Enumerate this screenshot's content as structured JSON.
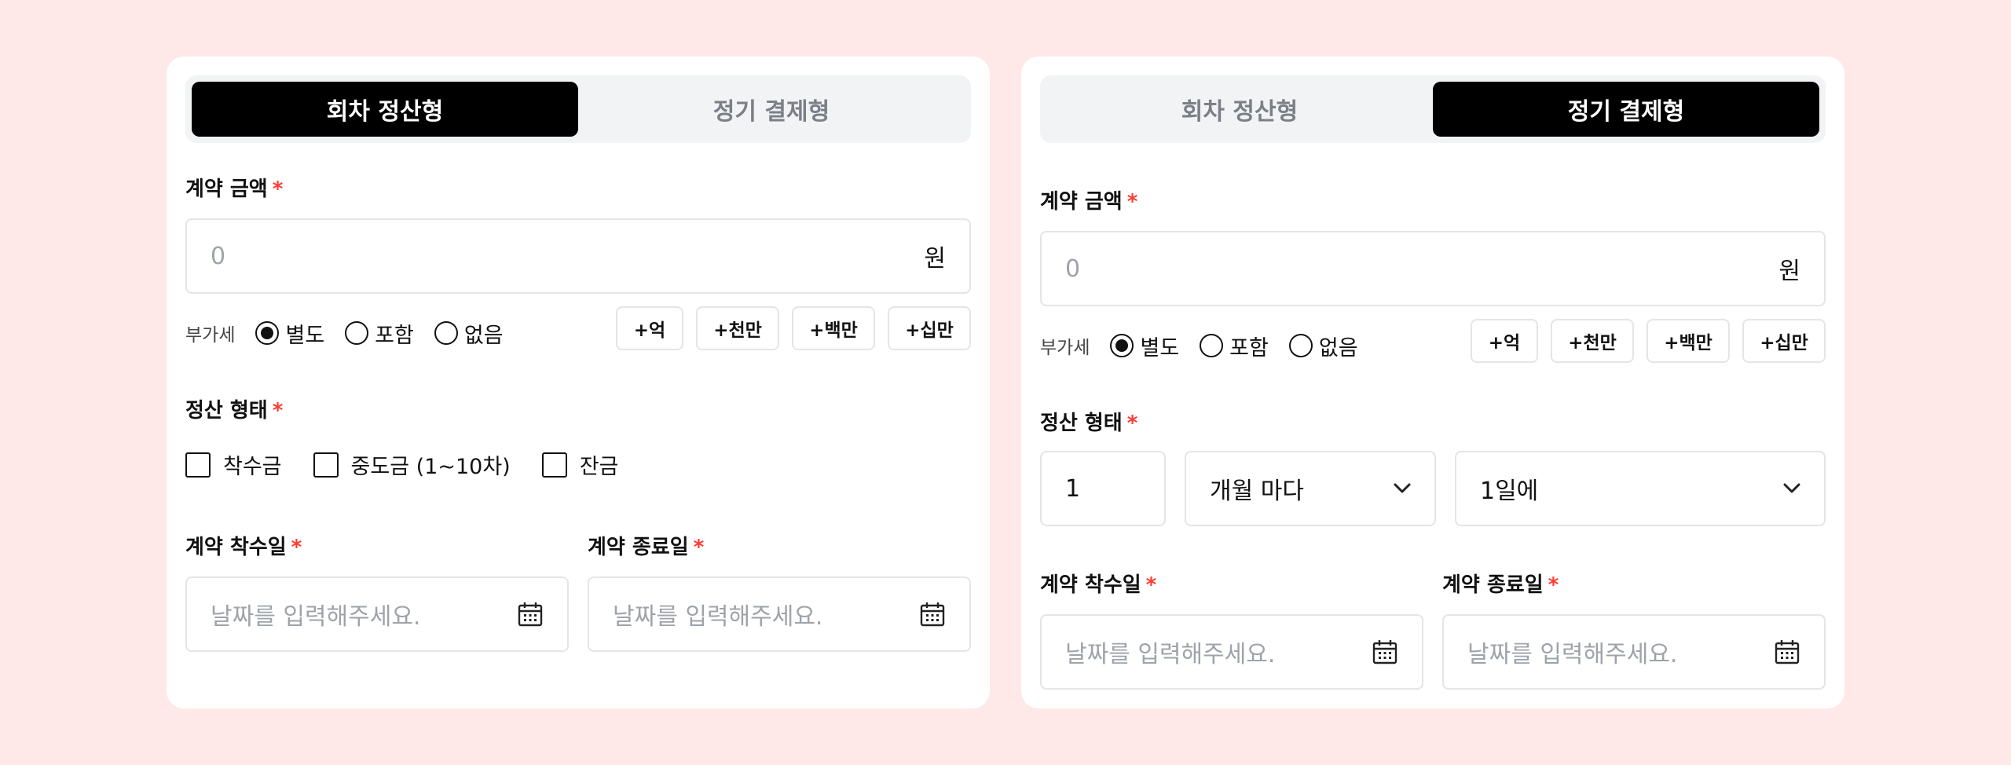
{
  "left_card": {
    "tabs": [
      {
        "label": "회차 정산형",
        "active": true
      },
      {
        "label": "정기 결제형",
        "active": false
      }
    ],
    "amount_label": "계약 금액",
    "amount_placeholder": "0",
    "amount_unit": "원",
    "vat_label": "부가세",
    "vat_options": [
      {
        "label": "별도",
        "selected": true
      },
      {
        "label": "포함",
        "selected": false
      },
      {
        "label": "없음",
        "selected": false
      }
    ],
    "quick_buttons": [
      "+억",
      "+천만",
      "+백만",
      "+십만"
    ],
    "settlement_label": "정산 형태",
    "settlement_checks": [
      "착수금",
      "중도금 (1~10차)",
      "잔금"
    ],
    "start_label": "계약 착수일",
    "end_label": "계약 종료일",
    "date_placeholder": "날짜를 입력해주세요."
  },
  "right_card": {
    "tabs": [
      {
        "label": "회차 정산형",
        "active": false
      },
      {
        "label": "정기 결제형",
        "active": true
      }
    ],
    "amount_label": "계약 금액",
    "amount_placeholder": "0",
    "amount_unit": "원",
    "vat_label": "부가세",
    "vat_options": [
      {
        "label": "별도",
        "selected": true
      },
      {
        "label": "포함",
        "selected": false
      },
      {
        "label": "없음",
        "selected": false
      }
    ],
    "quick_buttons": [
      "+억",
      "+천만",
      "+백만",
      "+십만"
    ],
    "settlement_label": "정산 형태",
    "period_value": "1",
    "period_unit": "개월 마다",
    "day_value": "1일에",
    "start_label": "계약 착수일",
    "end_label": "계약 종료일",
    "date_placeholder": "날짜를 입력해주세요."
  },
  "required_mark": "*",
  "colors": {
    "background": "#ffe9e8",
    "active_tab": "#000000",
    "required": "#ff3b30",
    "placeholder": "#9ea3aa"
  },
  "icons": [
    "calendar-icon",
    "chevron-down-icon"
  ]
}
